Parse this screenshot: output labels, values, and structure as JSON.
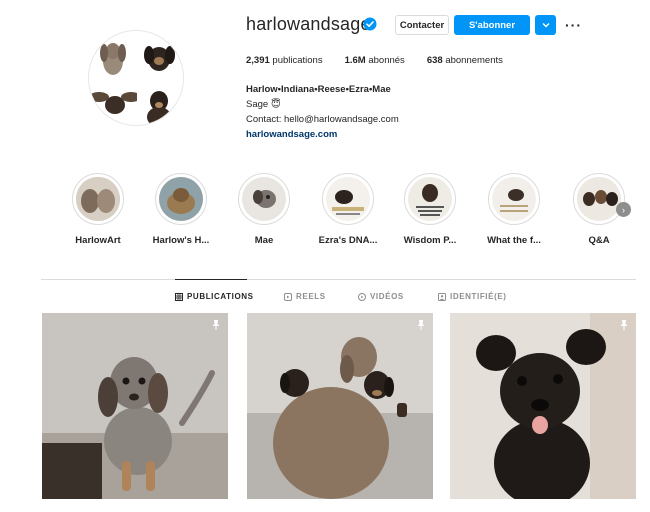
{
  "profile": {
    "username": "harlowandsage",
    "verified": true,
    "contact_label": "Contacter",
    "follow_label": "S'abonner",
    "more_label": "⌄",
    "options_label": "···",
    "stats": {
      "posts_count": "2,391",
      "posts_label": "publications",
      "followers_count": "1.6M",
      "followers_label": "abonnés",
      "following_count": "638",
      "following_label": "abonnements"
    },
    "bio": {
      "name": "Harlow•Indiana•Reese•Ezra•Mae",
      "line2": "Sage 😇",
      "contact": "Contact: hello@harlowandsage.com",
      "link": "harlowandsage.com"
    }
  },
  "highlights": [
    {
      "label": "HarlowArt"
    },
    {
      "label": "Harlow's H..."
    },
    {
      "label": "Mae"
    },
    {
      "label": "Ezra's DNA..."
    },
    {
      "label": "Wisdom P..."
    },
    {
      "label": "What the f..."
    },
    {
      "label": "Q&A"
    }
  ],
  "highlights_next_icon": "›",
  "tabs": [
    {
      "label": "PUBLICATIONS",
      "icon": "grid-icon",
      "active": true
    },
    {
      "label": "REELS",
      "icon": "reels-icon",
      "active": false
    },
    {
      "label": "VIDÉOS",
      "icon": "video-icon",
      "active": false
    },
    {
      "label": "IDENTIFIÉ(E)",
      "icon": "tagged-icon",
      "active": false
    }
  ],
  "posts": [
    {
      "subject": "merle dachshund puppy",
      "pinned": true
    },
    {
      "subject": "weimaraner with two dachshunds",
      "pinned": true
    },
    {
      "subject": "black puppy with tongue out",
      "pinned": true
    }
  ],
  "colors": {
    "accent": "#0095f6",
    "link": "#00376b",
    "text": "#262626",
    "muted": "#8e8e8e",
    "border": "#dbdbdb"
  }
}
